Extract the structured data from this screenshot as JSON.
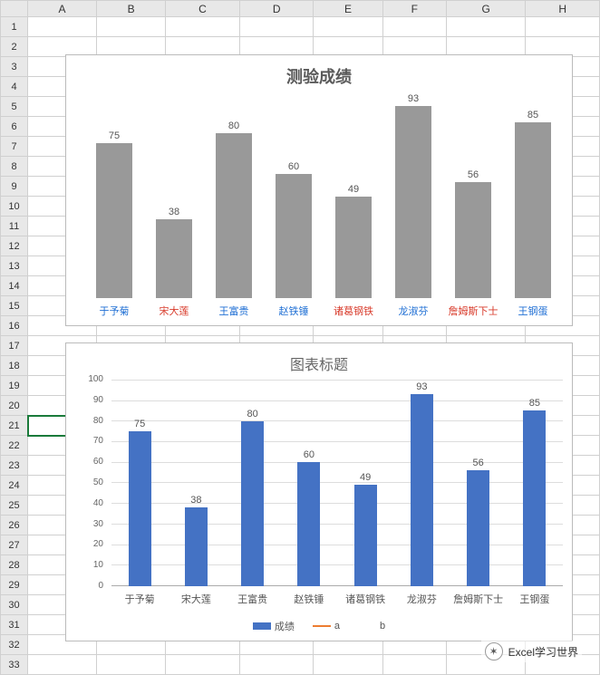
{
  "columns": [
    "A",
    "B",
    "C",
    "D",
    "E",
    "F",
    "G",
    "H"
  ],
  "rows_count": 33,
  "selected_cell": {
    "row": 21,
    "col": 0
  },
  "chart_data": [
    {
      "type": "bar",
      "title": "测验成绩",
      "categories": [
        "于予菊",
        "宋大莲",
        "王富贵",
        "赵铁锤",
        "诸葛钢铁",
        "龙淑芬",
        "詹姆斯下士",
        "王钢蛋"
      ],
      "values": [
        75,
        38,
        80,
        60,
        49,
        93,
        56,
        85
      ],
      "category_colors": [
        "blue",
        "red",
        "blue",
        "blue",
        "red",
        "blue",
        "red",
        "blue"
      ],
      "data_labels": true,
      "ylim": [
        0,
        100
      ]
    },
    {
      "type": "bar",
      "title": "图表标题",
      "categories": [
        "于予菊",
        "宋大莲",
        "王富贵",
        "赵铁锤",
        "诸葛钢铁",
        "龙淑芬",
        "詹姆斯下士",
        "王钢蛋"
      ],
      "series": [
        {
          "name": "成绩",
          "type": "bar",
          "values": [
            75,
            38,
            80,
            60,
            49,
            93,
            56,
            85
          ]
        },
        {
          "name": "a",
          "type": "line",
          "values": []
        },
        {
          "name": "b",
          "type": "line",
          "values": []
        }
      ],
      "data_labels": true,
      "ylabel": "",
      "ylim": [
        0,
        100
      ],
      "yticks": [
        0,
        10,
        20,
        30,
        40,
        50,
        60,
        70,
        80,
        90,
        100
      ],
      "legend": [
        "成绩",
        "a",
        "b"
      ]
    }
  ],
  "watermark": {
    "icon": "wechat-icon",
    "text": "Excel学习世界"
  }
}
